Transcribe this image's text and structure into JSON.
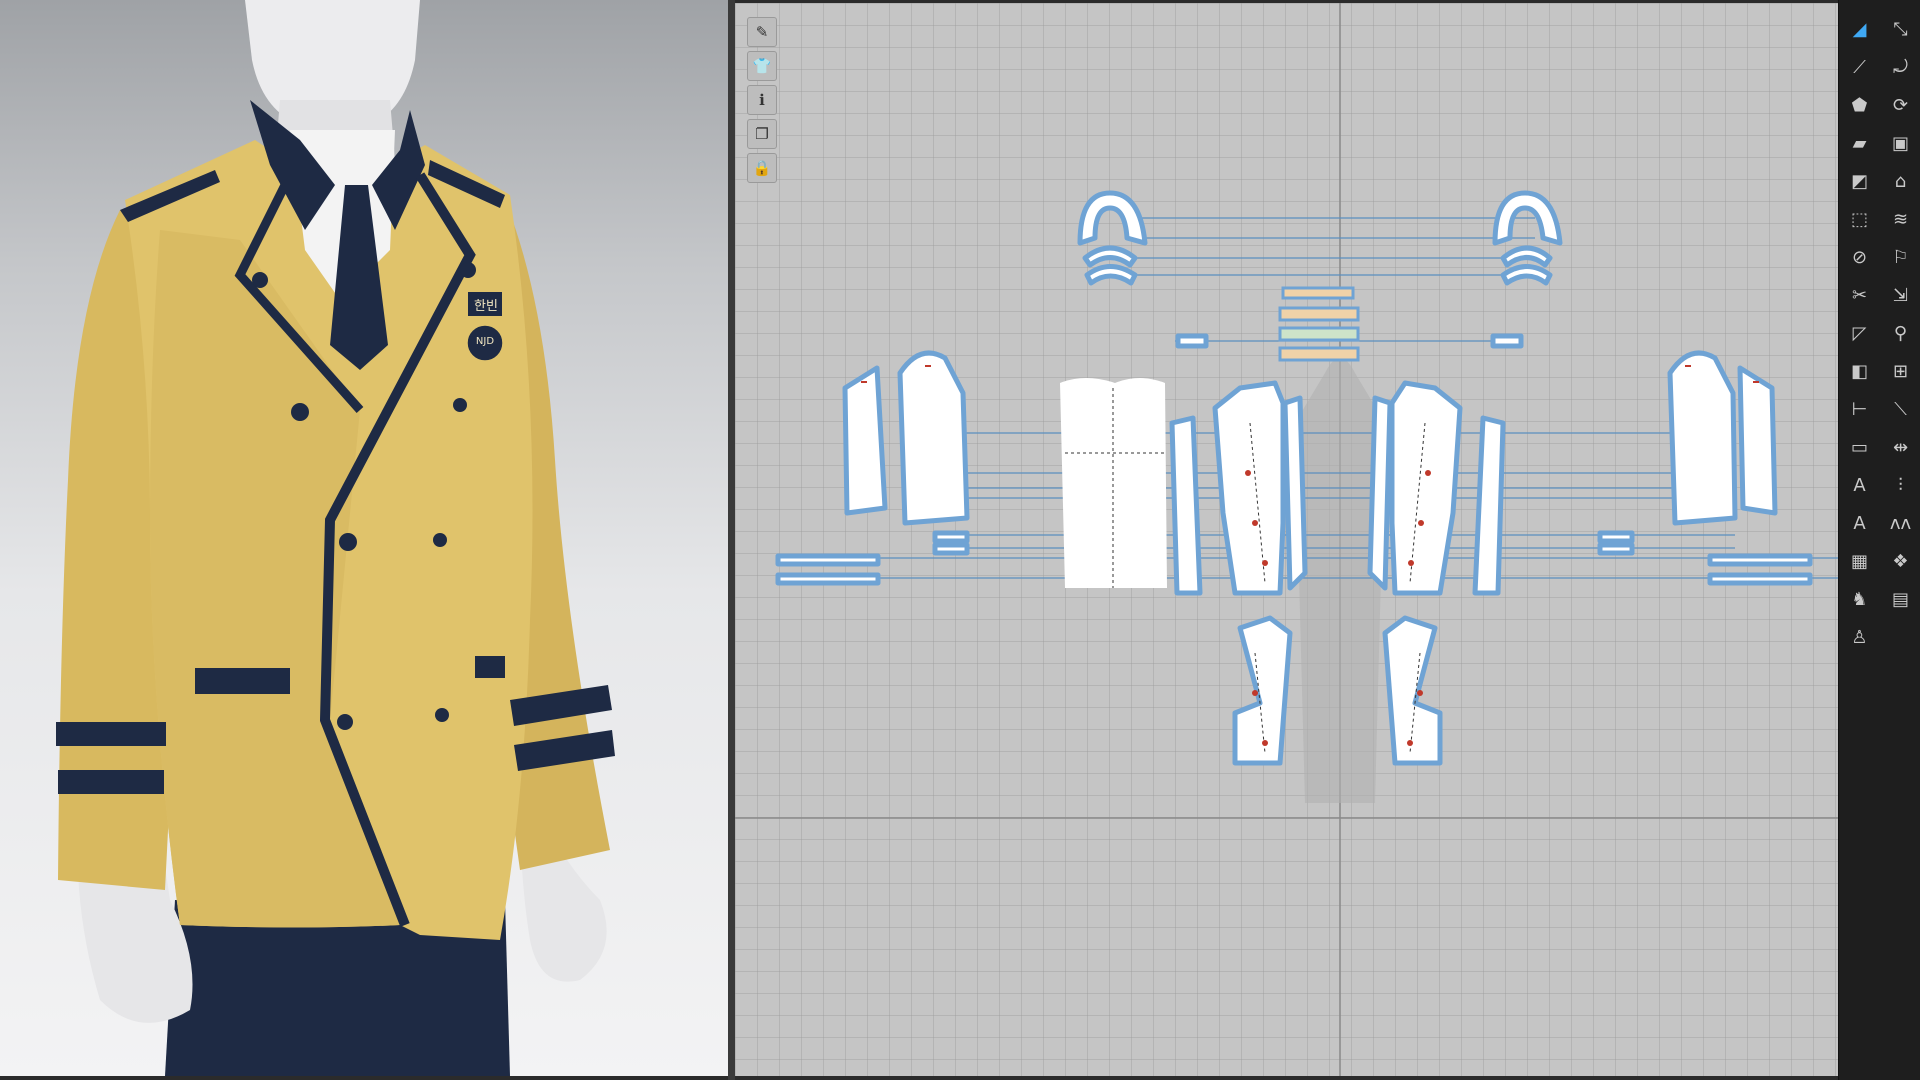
{
  "colors": {
    "jacket": "#e0c36b",
    "jacket_shade": "#c9a955",
    "trim": "#1e2a44",
    "shirt": "#f2f2f2",
    "mannequin": "#e8e8ea",
    "pattern_fill": "#ffffff",
    "pattern_outline": "#6fa3d4",
    "seam_red": "#c0392b",
    "accent": "#3fa9f5"
  },
  "badge": {
    "name_tag": "한빈",
    "emblem": "NJD"
  },
  "toolbar_2d": [
    {
      "icon": "brush-icon",
      "glyph": "✎"
    },
    {
      "icon": "garment-icon",
      "glyph": "👕"
    },
    {
      "icon": "info-icon",
      "glyph": "ℹ"
    },
    {
      "icon": "copy-icon",
      "glyph": "❐"
    },
    {
      "icon": "lock-garment-icon",
      "glyph": "🔒"
    }
  ],
  "right_tools": [
    {
      "icon": "select-pattern-icon",
      "glyph": "◢"
    },
    {
      "icon": "transform-icon",
      "glyph": "⤡"
    },
    {
      "icon": "edit-point-icon",
      "glyph": "⟋"
    },
    {
      "icon": "curve-icon",
      "glyph": "⤾"
    },
    {
      "icon": "polygon-icon",
      "glyph": "⬟"
    },
    {
      "icon": "rotate-icon",
      "glyph": "⟳"
    },
    {
      "icon": "rectangle-icon",
      "glyph": "▰"
    },
    {
      "icon": "internal-rect-icon",
      "glyph": "▣"
    },
    {
      "icon": "trace-icon",
      "glyph": "◩"
    },
    {
      "icon": "iron-icon",
      "glyph": "⌂"
    },
    {
      "icon": "dotted-rect-icon",
      "glyph": "⬚"
    },
    {
      "icon": "fold-icon",
      "glyph": "≋"
    },
    {
      "icon": "seam-icon",
      "glyph": "⊘"
    },
    {
      "icon": "tack-icon",
      "glyph": "⚐"
    },
    {
      "icon": "cut-icon",
      "glyph": "✂"
    },
    {
      "icon": "sew-icon",
      "glyph": "⇲"
    },
    {
      "icon": "dart-icon",
      "glyph": "◸"
    },
    {
      "icon": "pin-icon",
      "glyph": "⚲"
    },
    {
      "icon": "button-icon",
      "glyph": "◧"
    },
    {
      "icon": "buttonhole-icon",
      "glyph": "⊞"
    },
    {
      "icon": "measure-icon",
      "glyph": "⊢"
    },
    {
      "icon": "ruler-icon",
      "glyph": "⟍"
    },
    {
      "icon": "tape-icon",
      "glyph": "▭"
    },
    {
      "icon": "length-icon",
      "glyph": "⇹"
    },
    {
      "icon": "text-small-icon",
      "glyph": "A"
    },
    {
      "icon": "zipper-icon",
      "glyph": "⫶"
    },
    {
      "icon": "text-large-icon",
      "glyph": "A"
    },
    {
      "icon": "stitch-icon",
      "glyph": "ʌʌ"
    },
    {
      "icon": "grade-icon",
      "glyph": "▦"
    },
    {
      "icon": "texture-icon",
      "glyph": "❖"
    },
    {
      "icon": "avatar-icon",
      "glyph": "♞"
    },
    {
      "icon": "gift-icon",
      "glyph": "▤"
    },
    {
      "icon": "figure-icon",
      "glyph": "♙"
    }
  ]
}
